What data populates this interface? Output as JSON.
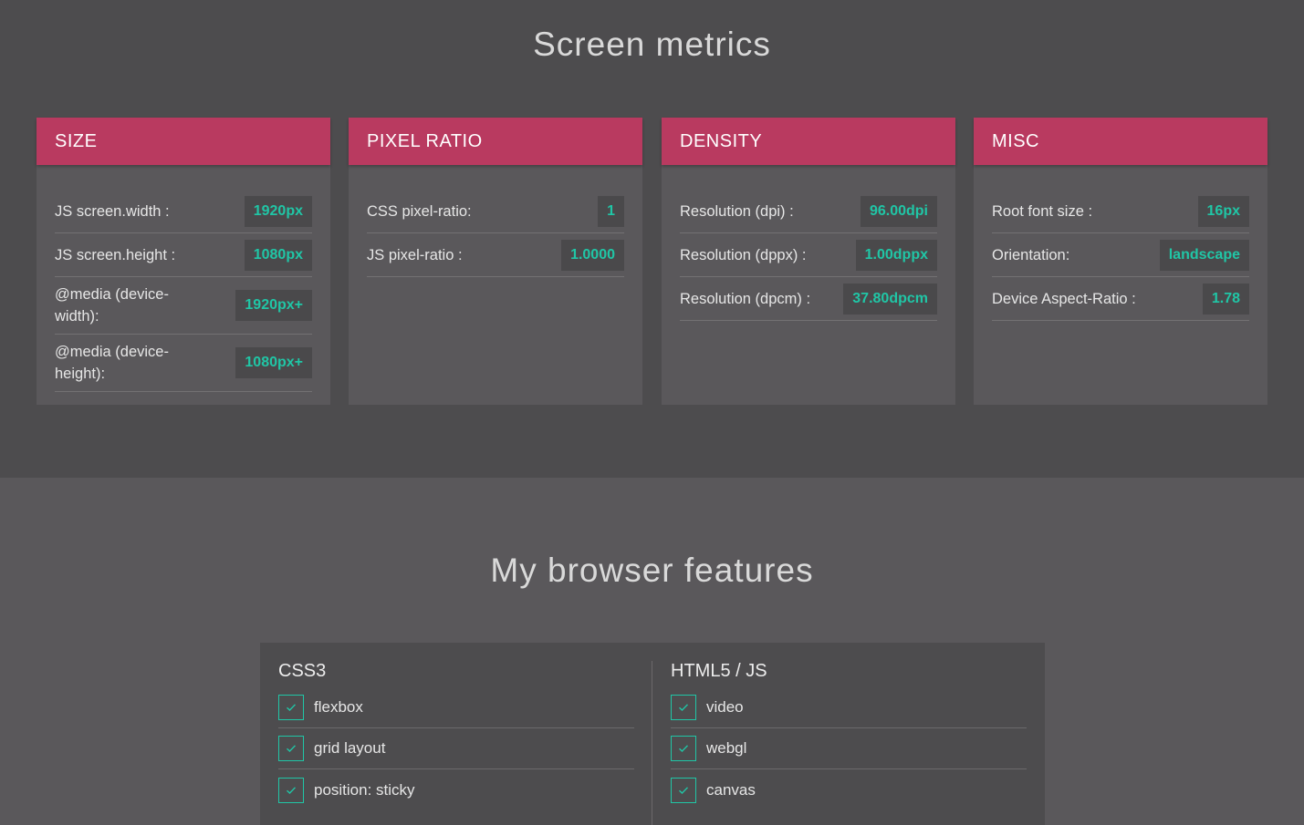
{
  "screen_metrics": {
    "title": "Screen metrics",
    "cards": [
      {
        "header": "SIZE",
        "rows": [
          {
            "label": "JS screen.width :",
            "value": "1920px"
          },
          {
            "label": "JS screen.height :",
            "value": "1080px"
          },
          {
            "label": "@media (device-width):",
            "value": "1920px+"
          },
          {
            "label": "@media (device-height):",
            "value": "1080px+"
          }
        ]
      },
      {
        "header": "PIXEL RATIO",
        "rows": [
          {
            "label": "CSS pixel-ratio:",
            "value": "1"
          },
          {
            "label": "JS pixel-ratio :",
            "value": "1.0000"
          }
        ]
      },
      {
        "header": "DENSITY",
        "rows": [
          {
            "label": "Resolution (dpi) :",
            "value": "96.00dpi"
          },
          {
            "label": "Resolution (dppx) :",
            "value": "1.00dppx"
          },
          {
            "label": "Resolution (dpcm) :",
            "value": "37.80dpcm"
          }
        ]
      },
      {
        "header": "MISC",
        "rows": [
          {
            "label": "Root font size :",
            "value": "16px"
          },
          {
            "label": "Orientation:",
            "value": "landscape"
          },
          {
            "label": "Device Aspect-Ratio :",
            "value": "1.78"
          }
        ]
      }
    ]
  },
  "browser_features": {
    "title": "My browser features",
    "columns": [
      {
        "title": "CSS3",
        "items": [
          "flexbox",
          "grid layout",
          "position: sticky"
        ]
      },
      {
        "title": "HTML5 / JS",
        "items": [
          "video",
          "webgl",
          "canvas"
        ]
      }
    ]
  },
  "icons": {
    "check": "check-icon"
  },
  "colors": {
    "accent": "#b93a60",
    "value_text": "#20c6a6",
    "background_dark": "#4d4c4e",
    "background": "#5a585b"
  }
}
